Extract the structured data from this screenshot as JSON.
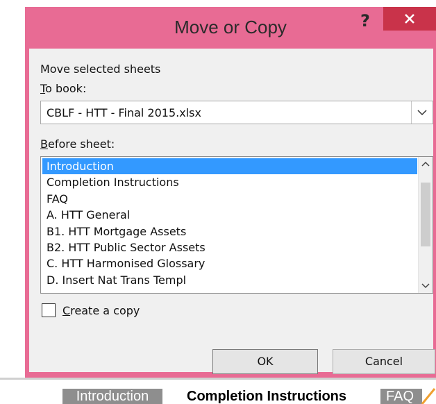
{
  "dialog": {
    "title": "Move or Copy",
    "help_label": "?",
    "move_label": "Move selected sheets",
    "to_book_prefix": "T",
    "to_book_rest": "o book:",
    "to_book_value": "CBLF - HTT - Final 2015.xlsx",
    "before_sheet_prefix": "B",
    "before_sheet_rest": "efore sheet:",
    "sheets": [
      "Introduction",
      "Completion Instructions",
      "FAQ",
      "A. HTT General",
      "B1. HTT Mortgage Assets",
      "B2. HTT Public Sector Assets",
      "C. HTT Harmonised Glossary",
      "D. Insert Nat Trans Templ"
    ],
    "selected_index": 0,
    "create_copy_prefix": "C",
    "create_copy_rest": "reate a copy",
    "create_copy_checked": false,
    "ok_label": "OK",
    "cancel_label": "Cancel"
  },
  "sheet_tabs": {
    "tab1": "Introduction",
    "tab2": "Completion Instructions",
    "tab3": "FAQ"
  },
  "colors": {
    "frame": "#e86b94",
    "close_button": "#c9334a",
    "selection": "#3399ff"
  }
}
